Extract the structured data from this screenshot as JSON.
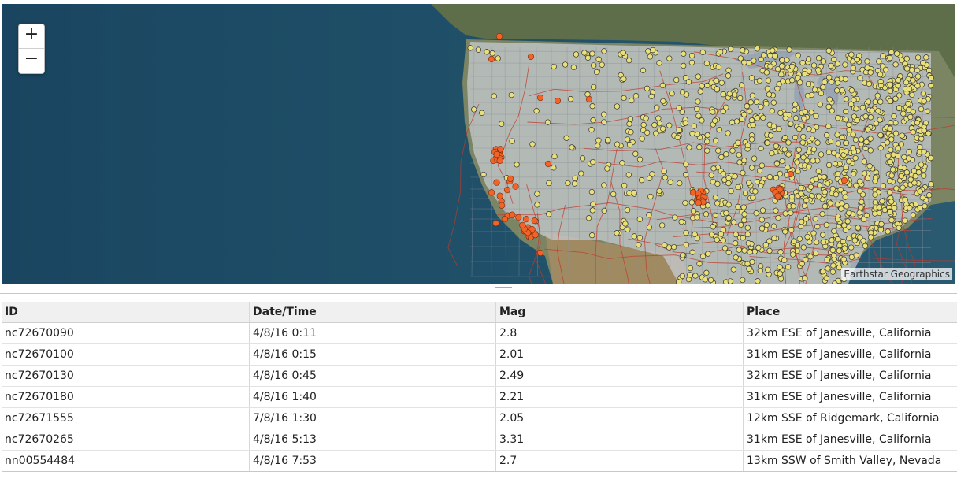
{
  "map": {
    "basemap_name": "satellite imagery",
    "attribution": "Earthstar Geographics",
    "zoom_in_label": "+",
    "zoom_out_label": "−",
    "colors": {
      "ocean": "#1d4a63",
      "land": "#8a9270",
      "overlay": "#c9cdd6",
      "roads": "#c0392b",
      "points": "#e9e07a",
      "quakes": "#f0642a"
    }
  },
  "table": {
    "columns": [
      "ID",
      "Date/Time",
      "Mag",
      "Place"
    ],
    "rows": [
      [
        "nc72670090",
        "4/8/16 0:11",
        "2.8",
        "32km ESE of Janesville, California"
      ],
      [
        "nc72670100",
        "4/8/16 0:15",
        "2.01",
        "31km ESE of Janesville, California"
      ],
      [
        "nc72670130",
        "4/8/16 0:45",
        "2.49",
        "32km ESE of Janesville, California"
      ],
      [
        "nc72670180",
        "4/8/16 1:40",
        "2.21",
        "31km ESE of Janesville, California"
      ],
      [
        "nc72671555",
        "7/8/16 1:30",
        "2.05",
        "12km SSE of Ridgemark, California"
      ],
      [
        "nc72670265",
        "4/8/16 5:13",
        "3.31",
        "31km ESE of Janesville, California"
      ],
      [
        "nn00554484",
        "4/8/16 7:53",
        "2.7",
        "13km SSW of Smith Valley, Nevada"
      ]
    ]
  }
}
